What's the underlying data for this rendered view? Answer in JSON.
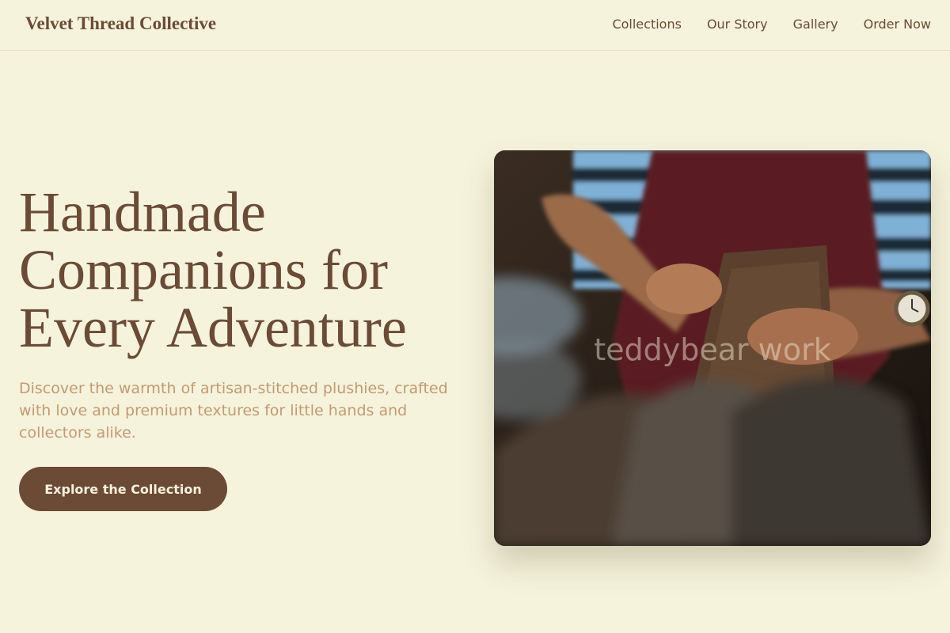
{
  "nav": {
    "brand": "Velvet Thread Collective",
    "links": [
      "Collections",
      "Our Story",
      "Gallery",
      "Order Now"
    ]
  },
  "hero": {
    "title_lines": [
      "Handmade",
      "Companions for",
      "Every Adventure"
    ],
    "subtitle": "Discover the warmth of artisan-stitched plushies, crafted with love and premium textures for little hands and collectors alike.",
    "cta_label": "Explore the Collection",
    "image_alt": "teddybear work"
  },
  "colors": {
    "background": "#f5f3dc",
    "primary": "#6b4a36",
    "subtitle": "#c39a72"
  }
}
